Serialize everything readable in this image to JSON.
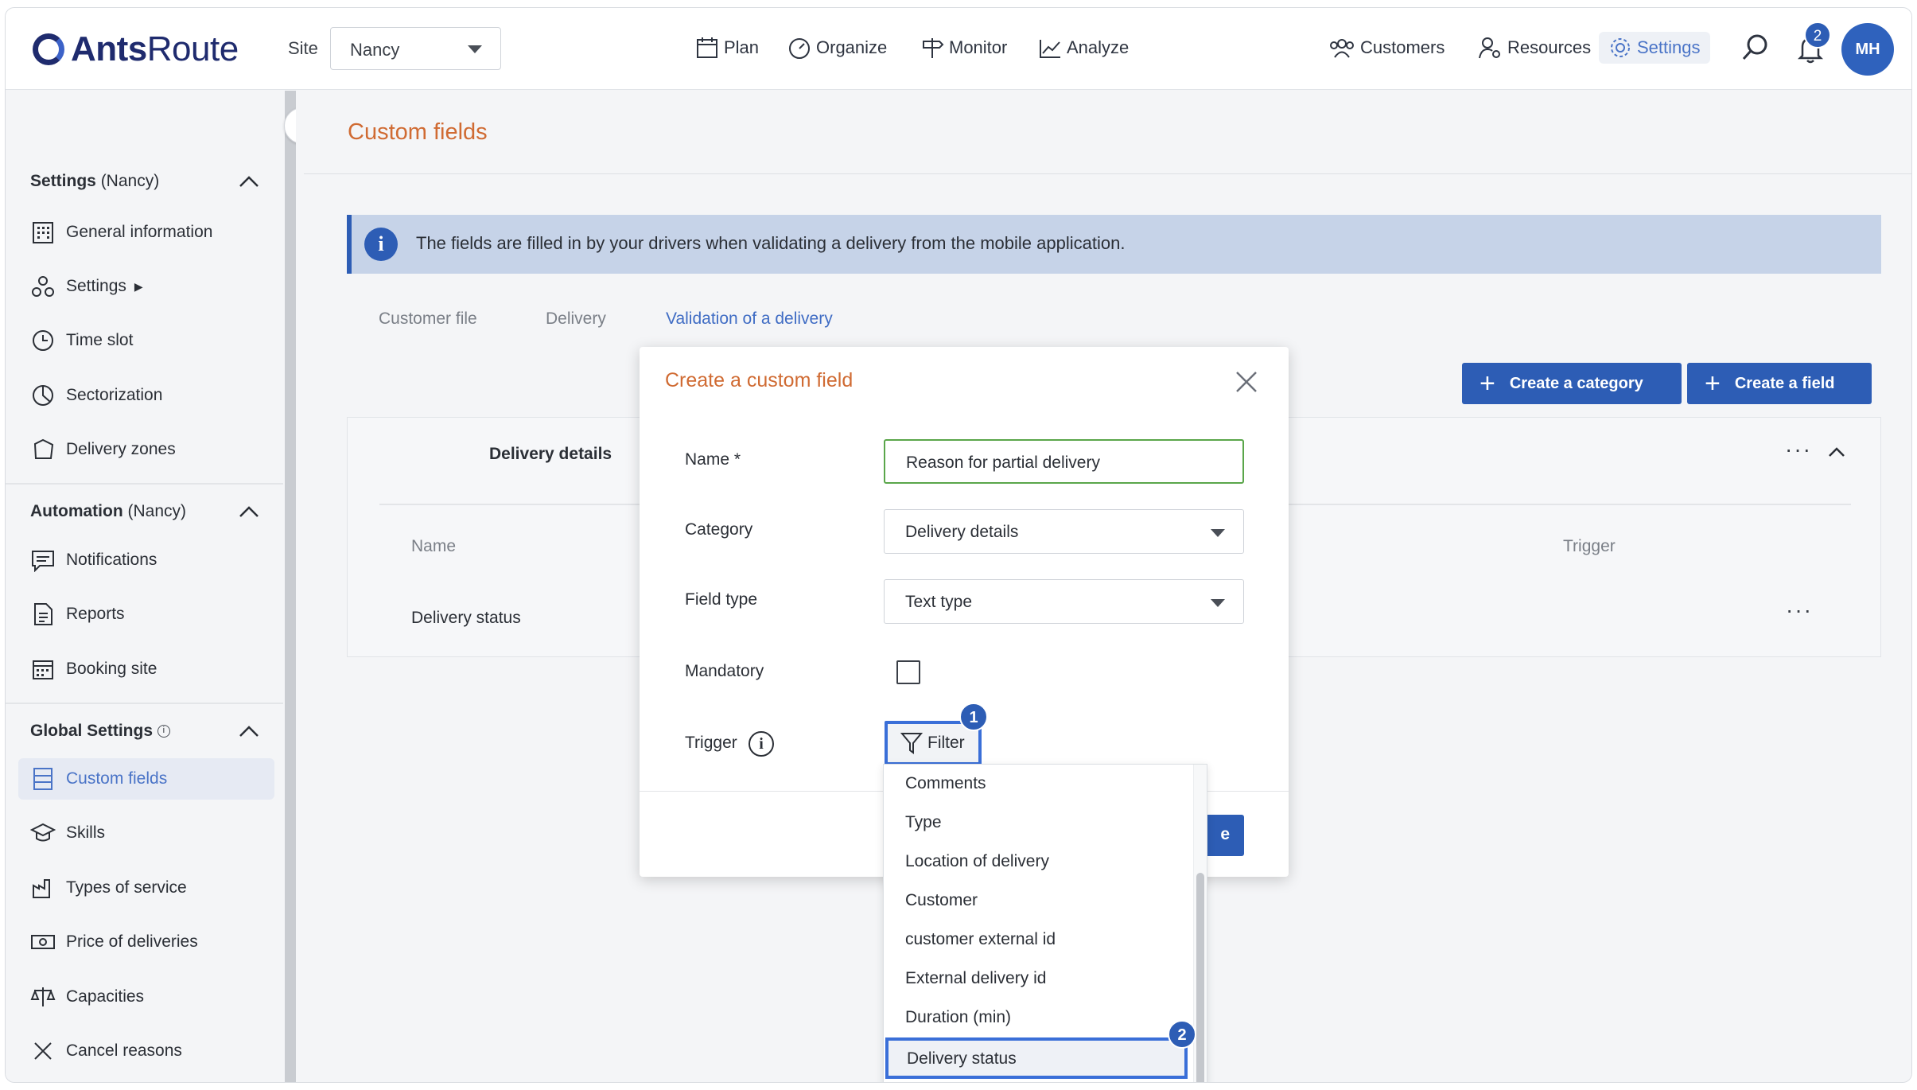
{
  "app": {
    "logo": "AntsRoute"
  },
  "header": {
    "site_label": "Site",
    "site_value": "Nancy",
    "nav": [
      "Plan",
      "Organize",
      "Monitor",
      "Analyze"
    ],
    "right_nav": [
      "Customers",
      "Resources",
      "Settings"
    ],
    "notification_count": "2",
    "avatar_initials": "MH"
  },
  "sidebar": {
    "sections": [
      {
        "title": "Settings",
        "suffix": "(Nancy)"
      },
      {
        "title": "Automation",
        "suffix": "(Nancy)"
      },
      {
        "title": "Global Settings",
        "suffix": ""
      }
    ],
    "items": [
      "General information",
      "Settings",
      "Time slot",
      "Sectorization",
      "Delivery zones",
      "Notifications",
      "Reports",
      "Booking site",
      "Custom fields",
      "Skills",
      "Types of service",
      "Price of deliveries",
      "Capacities",
      "Cancel reasons"
    ],
    "settings_arrow": "▶"
  },
  "main": {
    "title": "Custom fields",
    "info": "The fields are filled in by your drivers when validating a delivery from the mobile application.",
    "tabs": [
      "Customer file",
      "Delivery",
      "Validation of a delivery"
    ],
    "create_category": "Create a category",
    "create_field": "Create a field",
    "card": {
      "category": "Delivery details",
      "col_name": "Name",
      "col_trigger": "Trigger",
      "row_name": "Delivery status"
    }
  },
  "modal": {
    "title": "Create a custom field",
    "name_label": "Name *",
    "name_value": "Reason for partial delivery",
    "category_label": "Category",
    "category_value": "Delivery details",
    "field_type_label": "Field type",
    "field_type_value": "Text type",
    "mandatory_label": "Mandatory",
    "trigger_label": "Trigger",
    "filter_label": "Filter",
    "save_peek": "e"
  },
  "dropdown": {
    "options": [
      "Comments",
      "Type",
      "Location of delivery",
      "Customer",
      "customer external id",
      "External delivery id",
      "Duration (min)",
      "Delivery status"
    ],
    "selected": "Delivery status"
  },
  "steps": [
    "1",
    "2"
  ]
}
